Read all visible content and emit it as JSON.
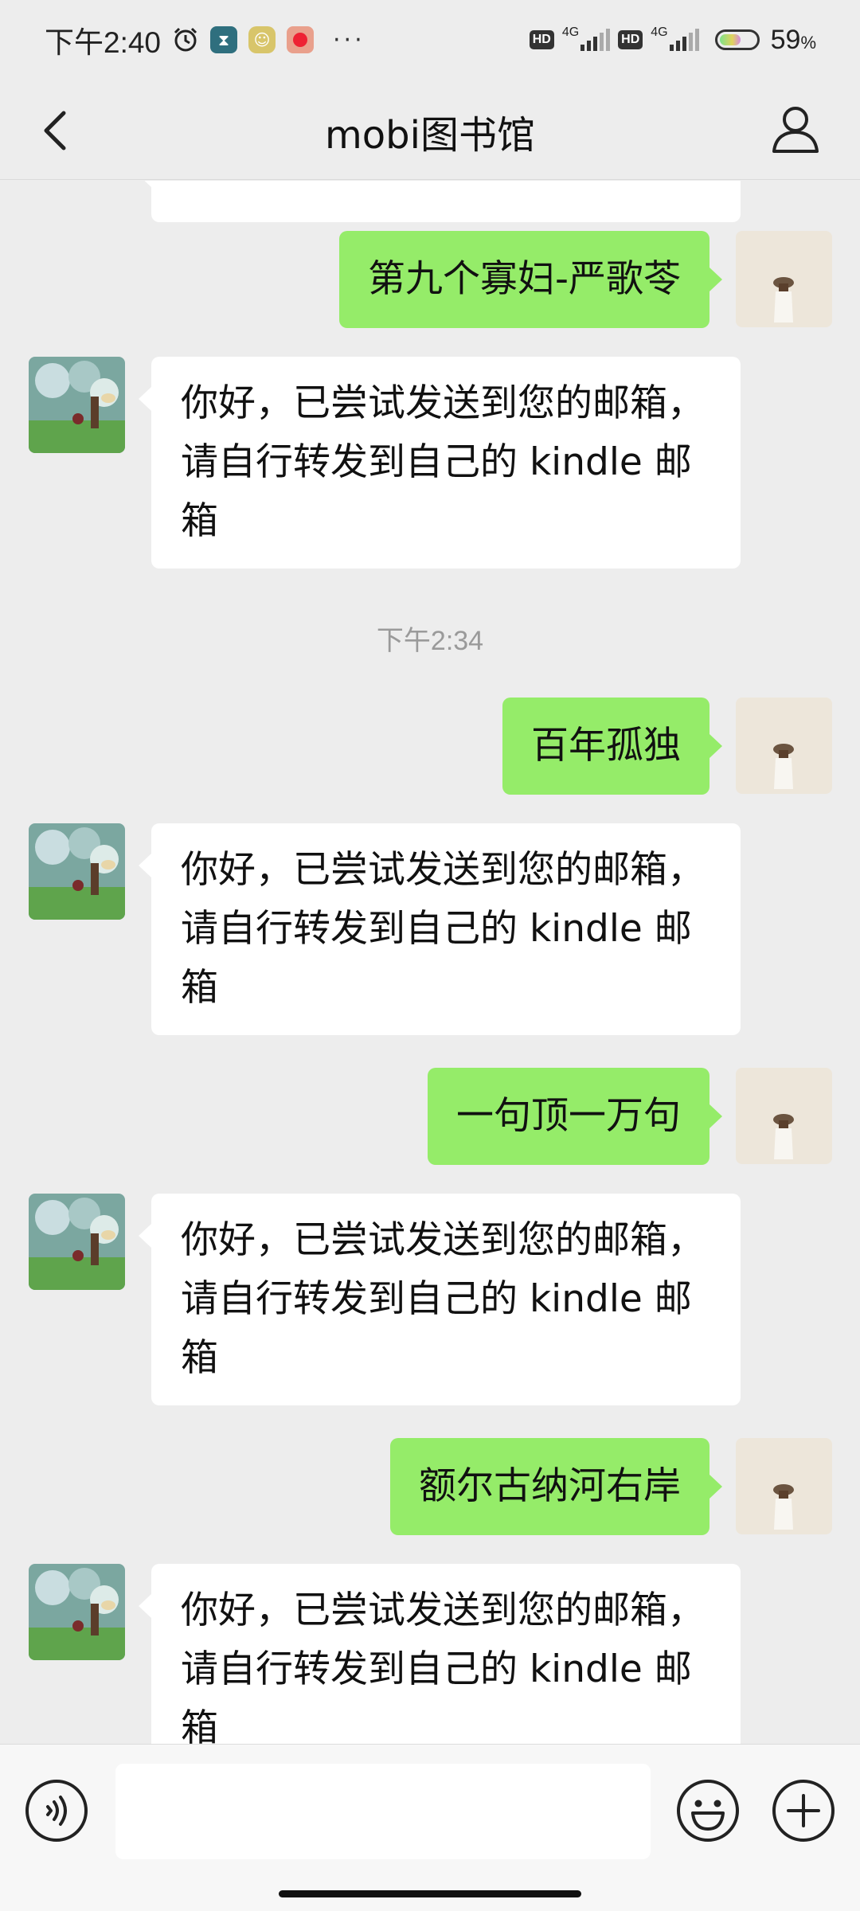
{
  "status_bar": {
    "time": "下午2:40",
    "more": "···",
    "hd_label": "HD",
    "network_label": "4G",
    "battery_percent": "59",
    "battery_unit": "%",
    "battery_level": 0.59,
    "icons": [
      "alarm-icon",
      "hourglass-app-icon",
      "emoji-app-icon",
      "red-app-icon"
    ]
  },
  "header": {
    "title": "mobi图书馆",
    "back_icon": "chevron-left-icon",
    "profile_icon": "person-icon"
  },
  "messages": {
    "reply_text": "你好，已尝试发送到您的邮箱，请自行转发到自己的 kindle 邮箱",
    "req1": "第九个寡妇-严歌苓",
    "timestamp": "下午2:34",
    "req2": "百年孤独",
    "req3": "一句顶一万句",
    "req4": "额尔古纳河右岸"
  },
  "input_bar": {
    "placeholder": "",
    "voice_icon": "voice-icon",
    "emoji_icon": "emoji-icon",
    "plus_icon": "plus-icon"
  },
  "colors": {
    "background": "#EDEDED",
    "sent_bubble": "#95EC69",
    "received_bubble": "#FFFFFF",
    "timestamp_text": "#9A9A9A"
  }
}
